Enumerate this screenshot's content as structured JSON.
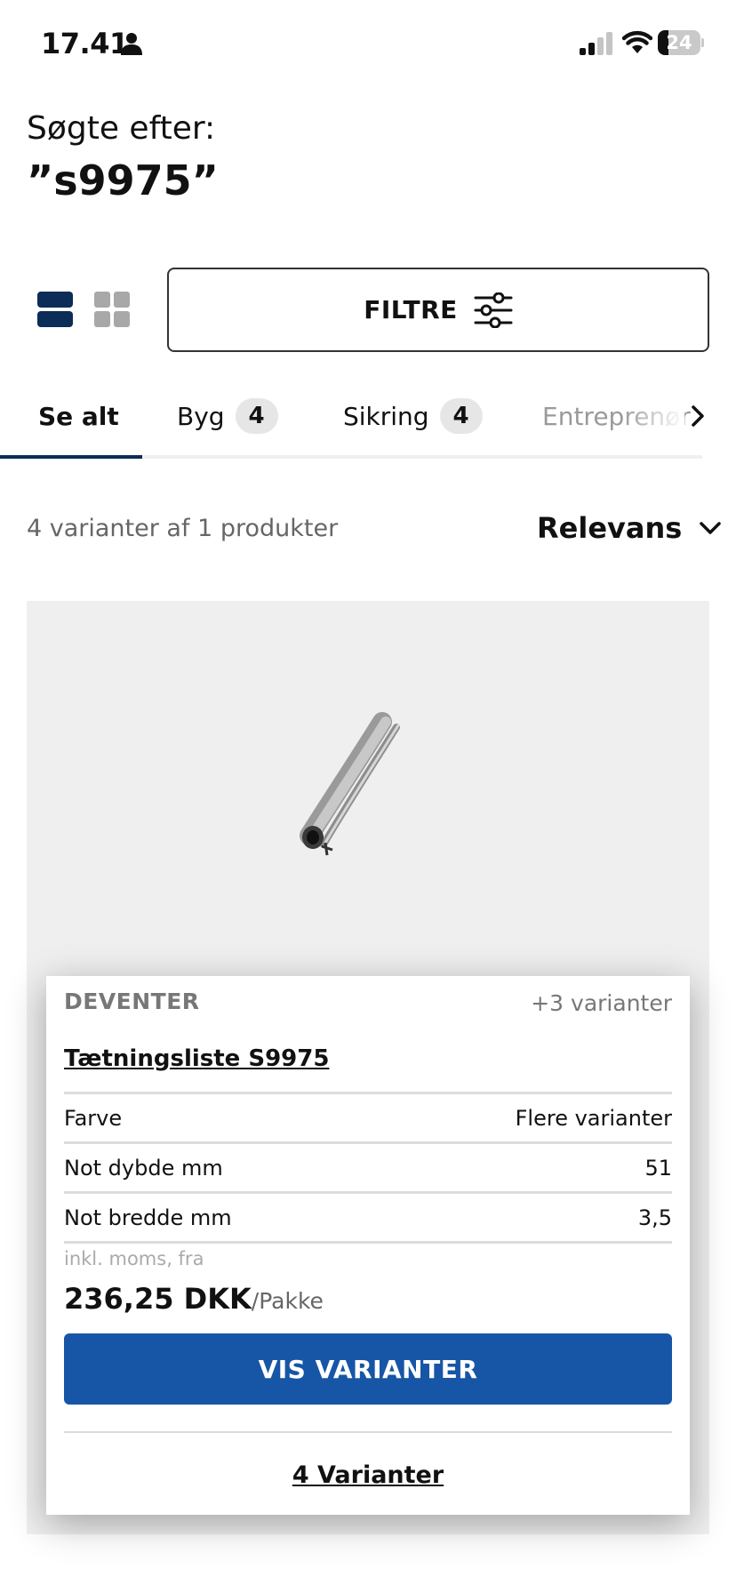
{
  "status_bar": {
    "time": "17.41",
    "battery": "24",
    "battery_level": 0.24
  },
  "search": {
    "label": "Søgte efter:",
    "query": "”s9975”"
  },
  "view_toggle": {
    "list_icon": "list-view-icon",
    "grid_icon": "grid-view-icon",
    "active": "list"
  },
  "filter": {
    "label": "FILTRE",
    "icon": "sliders-icon"
  },
  "tabs": [
    {
      "label": "Se alt",
      "count": ""
    },
    {
      "label": "Byg",
      "count": "4"
    },
    {
      "label": "Sikring",
      "count": "4"
    },
    {
      "label": "Entreprenør",
      "count": ""
    }
  ],
  "results": {
    "count_text": "4 varianter af 1 produkter",
    "sort_label": "Relevans"
  },
  "product": {
    "brand": "DEVENTER",
    "variant_count": "+3 varianter",
    "name": "Tætningsliste S9975",
    "specs": [
      {
        "label": "Farve",
        "value": "Flere varianter"
      },
      {
        "label": "Not dybde mm",
        "value": "51"
      },
      {
        "label": "Not bredde mm",
        "value": "3,5"
      }
    ],
    "price_note": "inkl. moms, fra",
    "price": "236,25 DKK",
    "price_unit": "/Pakke",
    "cta_label": "VIS VARIANTER",
    "variants_link": "4 Varianter"
  },
  "colors": {
    "primary_blue": "#1756a6",
    "navy": "#0b2d57",
    "card_bg": "#efefef"
  }
}
